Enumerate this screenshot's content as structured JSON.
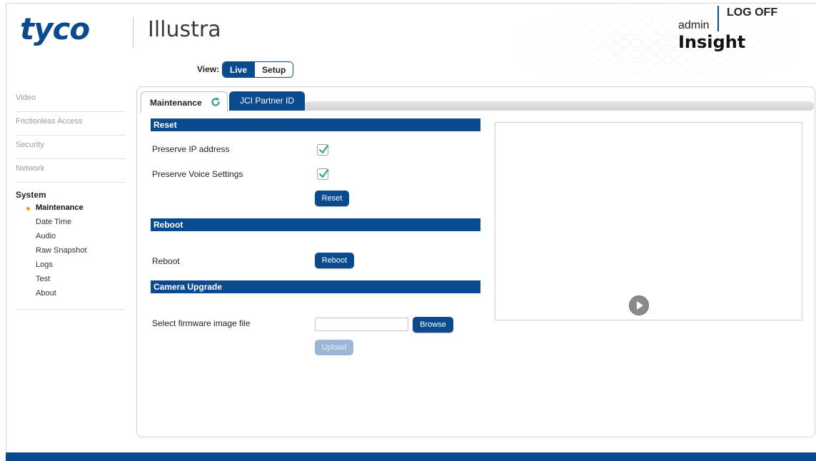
{
  "header": {
    "logo": "tyco",
    "product": "Illustra",
    "user": "admin",
    "logoff_label": "LOG OFF",
    "brand": "Insight"
  },
  "view": {
    "label": "View:",
    "live_label": "Live",
    "setup_label": "Setup",
    "selected": "Live"
  },
  "sidebar": {
    "items": [
      {
        "label": "Video"
      },
      {
        "label": "Frictionless Access"
      },
      {
        "label": "Security"
      },
      {
        "label": "Network"
      }
    ],
    "system_label": "System",
    "sub_items": [
      {
        "label": "Maintenance",
        "active": true
      },
      {
        "label": "Date Time"
      },
      {
        "label": "Audio"
      },
      {
        "label": "Raw Snapshot"
      },
      {
        "label": "Logs"
      },
      {
        "label": "Test"
      },
      {
        "label": "About"
      }
    ]
  },
  "tabs": {
    "maintenance": "Maintenance",
    "partner": "JCI Partner ID"
  },
  "reset_section": {
    "title": "Reset",
    "preserve_ip_label": "Preserve IP address",
    "preserve_ip_checked": true,
    "preserve_voice_label": "Preserve Voice Settings",
    "preserve_voice_checked": true,
    "button": "Reset"
  },
  "reboot_section": {
    "title": "Reboot",
    "label": "Reboot",
    "button": "Reboot"
  },
  "upgrade_section": {
    "title": "Camera Upgrade",
    "label": "Select firmware image file",
    "file_value": "",
    "browse_button": "Browse",
    "upload_button": "Upload"
  },
  "colors": {
    "accent": "#0a4a8f",
    "active_bullet": "#f0a100",
    "check": "#2a9d8f"
  }
}
